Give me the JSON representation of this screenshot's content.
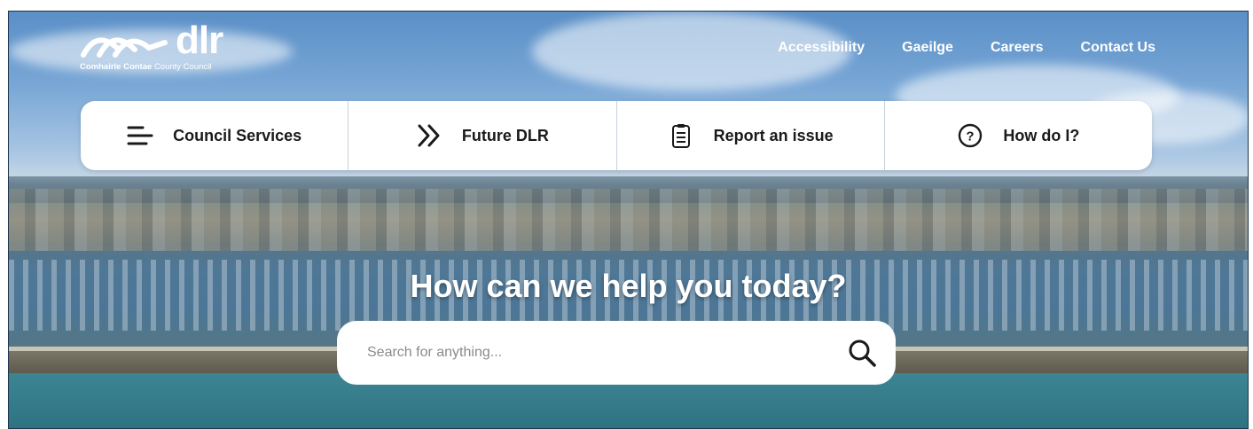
{
  "brand": {
    "name": "dlr",
    "subtitle_bold": "Comhairle Contae",
    "subtitle_rest": "County Council"
  },
  "topnav": {
    "items": [
      {
        "label": "Accessibility"
      },
      {
        "label": "Gaeilge"
      },
      {
        "label": "Careers"
      },
      {
        "label": "Contact Us"
      }
    ]
  },
  "menu": {
    "items": [
      {
        "label": "Council Services",
        "icon": "menu-lines-icon"
      },
      {
        "label": "Future DLR",
        "icon": "double-chevron-right-icon"
      },
      {
        "label": "Report an issue",
        "icon": "clipboard-icon"
      },
      {
        "label": "How do I?",
        "icon": "question-circle-icon"
      }
    ]
  },
  "hero": {
    "headline": "How can we help you today?"
  },
  "search": {
    "placeholder": "Search for anything...",
    "icon": "search-icon"
  },
  "colors": {
    "text_dark": "#1a1a1a",
    "white": "#ffffff"
  }
}
